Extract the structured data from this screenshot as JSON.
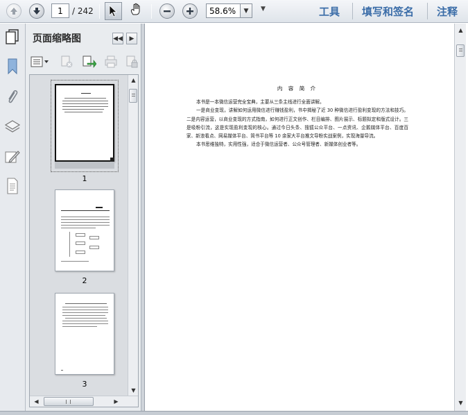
{
  "toolbar": {
    "current_page": "1",
    "total_pages": "/ 242",
    "zoom": "58.6%",
    "tools_label": "工具",
    "sign_label": "填写和签名",
    "comment_label": "注释"
  },
  "sidebar": {
    "title": "页面缩略图"
  },
  "thumbnails": [
    {
      "page": "1"
    },
    {
      "page": "2"
    },
    {
      "page": "3"
    }
  ],
  "document": {
    "title": "内 容 简 介",
    "paragraphs": [
      "本书是一本微信运营完全宝典，主要从三条主线进行全面讲解。",
      "一是商业变现，讲解如何运用微信进行赚钱盈利，书中揭秘了近 30 种微信进行盈利变现的方法和技巧。二是内容运营，以商业变现的方式指南，如何进行正文创作、栏目编排、图片展示、标题拟定和版式设计。三是吸粉引流，这是实现盈利变现的核心。通过今日头条、搜狐公众平台、一点资讯、企鹅媒体平台、百度百家、新浪看点、网易媒体平台、简书平台等 10 余家大平台推文导粉实战案例，实现海量导流。",
      "本书思维独特，实用性强，适合于微信运营者、公众号管理者、新媒体创业者等。"
    ]
  },
  "colors": {
    "link_blue": "#3b6da8",
    "panel_bg": "#e9ecef",
    "toolbar_bg": "#e3e7ec"
  },
  "icons": {
    "prev_page": "arrow-up-icon",
    "next_page": "arrow-down-icon",
    "select": "cursor-arrow-icon",
    "hand": "hand-icon",
    "zoom_out": "minus-icon",
    "zoom_in": "plus-icon"
  }
}
